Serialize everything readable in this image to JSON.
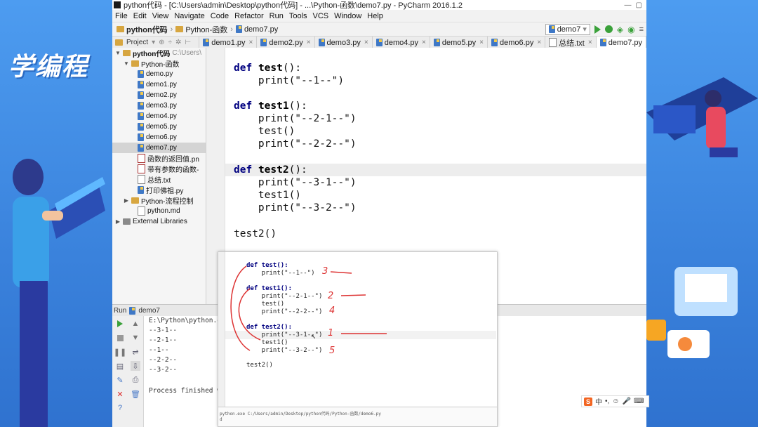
{
  "brand": "学编程",
  "window": {
    "title": "python代码 - [C:\\Users\\admin\\Desktop\\python代码] - ...\\Python-函数\\demo7.py - PyCharm 2016.1.2",
    "minimize": "—",
    "restore": "▢"
  },
  "menu": [
    "File",
    "Edit",
    "View",
    "Navigate",
    "Code",
    "Refactor",
    "Run",
    "Tools",
    "VCS",
    "Window",
    "Help"
  ],
  "breadcrumb": [
    "python代码",
    "Python-函数",
    "demo7.py"
  ],
  "run_config": "demo7",
  "project_header": "Project",
  "tabs": [
    {
      "label": "demo1.py"
    },
    {
      "label": "demo2.py"
    },
    {
      "label": "demo3.py"
    },
    {
      "label": "demo4.py"
    },
    {
      "label": "demo5.py"
    },
    {
      "label": "demo6.py"
    },
    {
      "label": "总结.txt"
    },
    {
      "label": "demo7.py"
    }
  ],
  "tree": {
    "root": "python代码",
    "root_path": "C:\\Users\\",
    "folder": "Python-函数",
    "files": [
      "demo.py",
      "demo1.py",
      "demo2.py",
      "demo3.py",
      "demo4.py",
      "demo5.py",
      "demo6.py",
      "demo7.py",
      "函数的返回值.pn",
      "带有参数的函数-",
      "总结.txt",
      "打印佛祖.py"
    ],
    "folder2": "Python-流程控制",
    "md": "python.md",
    "libs": "External Libraries"
  },
  "code": {
    "l1_def": "def",
    "l1_name": "test",
    "l1_rest": "():",
    "l2": "    print(\"--1--\")",
    "l4_def": "def",
    "l4_name": "test1",
    "l4_rest": "():",
    "l5": "    print(\"--2-1--\")",
    "l6": "    test()",
    "l7": "    print(\"--2-2--\")",
    "l9_def": "def",
    "l9_name": "test2",
    "l9_rest": "():",
    "l10": "    print(\"--3-1--\")",
    "l11": "    test1()",
    "l12": "    print(\"--3-2--\")",
    "l14": "test2()"
  },
  "run": {
    "title": "Run",
    "tab": "demo7",
    "lines": [
      "E:\\Python\\python.exe",
      "--3-1--",
      "--2-1--",
      "--1--",
      "--2-2--",
      "--3-2--",
      "",
      "Process finished wit"
    ]
  },
  "overlay": {
    "o1": "def test():",
    "o2": "    print(\"--1--\")",
    "o3": "def test1():",
    "o4": "    print(\"--2-1--\")",
    "o5": "    test()",
    "o6": "    print(\"--2-2--\")",
    "o7": "def test2():",
    "o8": "    print(\"--3-1--\")",
    "o9": "    test1()",
    "o10": "    print(\"--3-2--\")",
    "o11": "test2()",
    "notes": [
      "3",
      "2",
      "4",
      "1",
      "5"
    ],
    "foot1": "python.exe C:/Users/admin/Desktop/python代码/Python-函数/demo6.py",
    "foot2": "d"
  },
  "tray": {
    "ime": "中"
  },
  "colors": {
    "accent": "#3f8ae0",
    "keyword": "#000080",
    "string": "#008000",
    "annotation": "#d33333"
  }
}
